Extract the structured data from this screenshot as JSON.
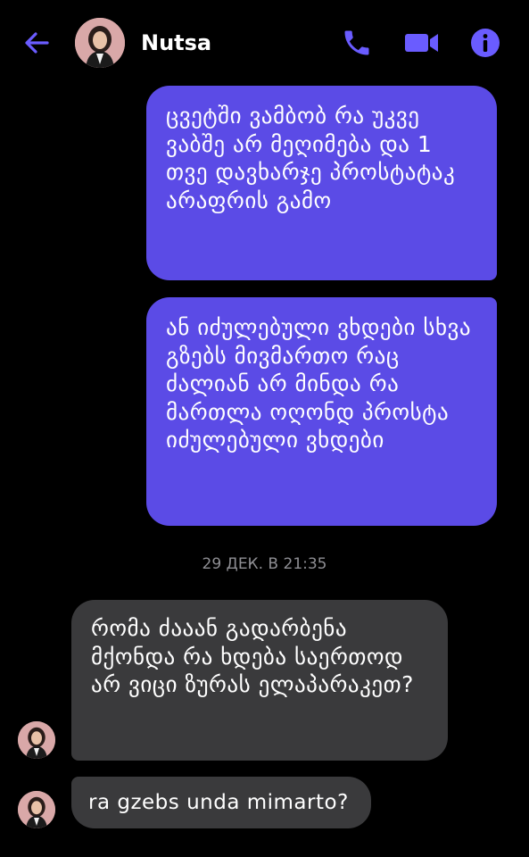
{
  "header": {
    "contact_name": "Nutsa",
    "icons": {
      "back": "arrow-left-icon",
      "call": "phone-icon",
      "video": "video-camera-icon",
      "info": "info-icon"
    },
    "accent_color": "#6a5cff"
  },
  "messages": [
    {
      "direction": "sent",
      "text": "ცვეტში ვამბობ რა უკვე ვაბშე არ მეღიმება და 1 თვე დავხარჯე პროსტატაკ არაფრის გამო"
    },
    {
      "direction": "sent",
      "text": "ან იძულებული ვხდები სხვა გზებს მივმართო რაც ძალიან არ მინდა რა მართლა ოღონდ პროსტა იძულებული ვხდები"
    },
    {
      "direction": "received",
      "text": "რომა ძააან გადარბენა მქონდა რა ხდება საერთოდ არ ვიცი ზურას ელაპარაკეთ?"
    },
    {
      "direction": "received",
      "text": "ra gzebs unda mimarto?"
    }
  ],
  "timestamp": "29 ДЕК. В 21:35",
  "colors": {
    "sent_bubble": "#5b4be6",
    "received_bubble": "#3a3a3c",
    "background": "#000000",
    "timestamp_text": "#8e8e93"
  }
}
